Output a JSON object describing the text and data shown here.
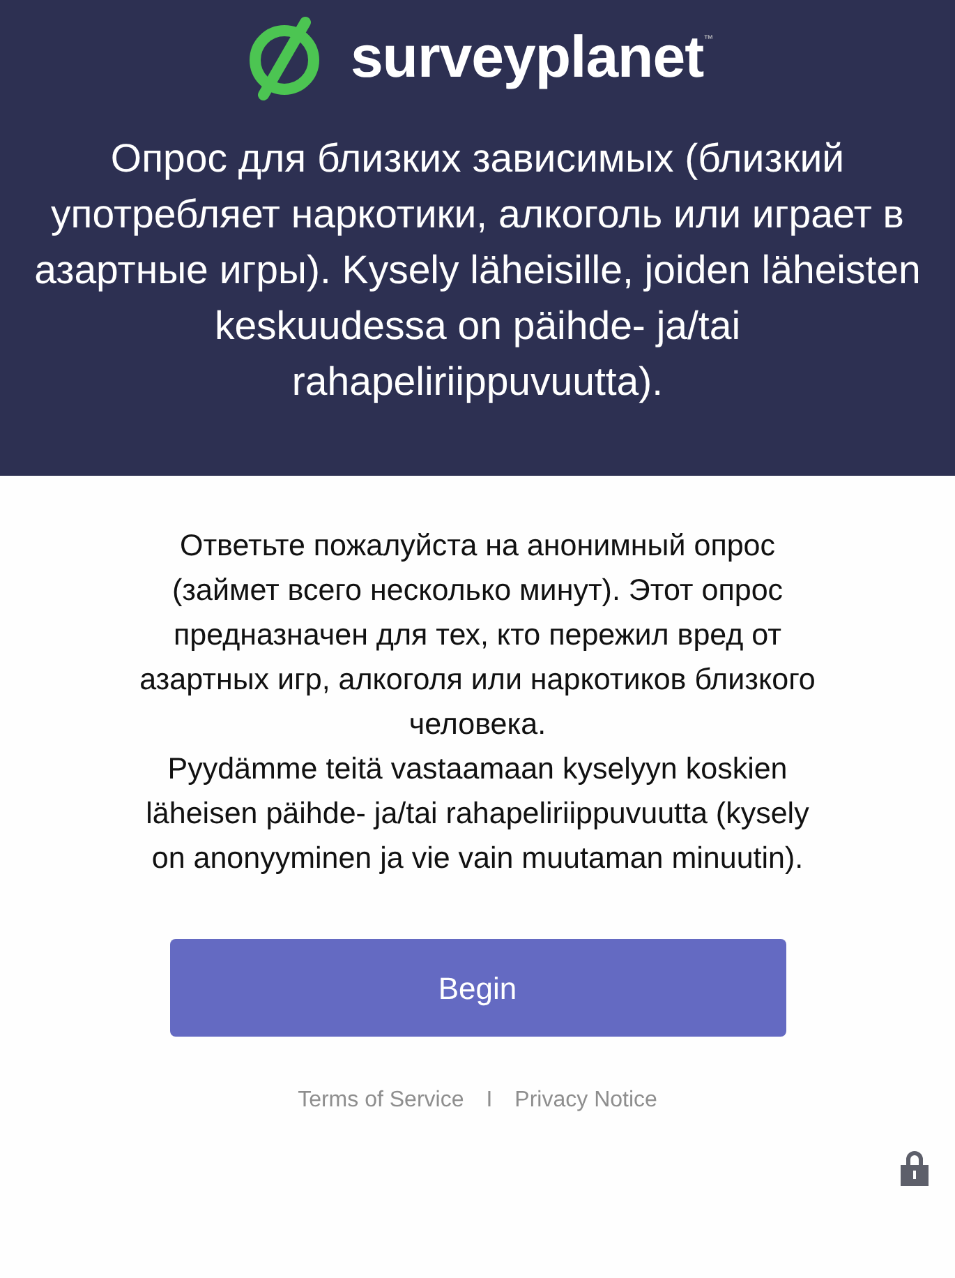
{
  "header": {
    "logo": {
      "name": "surveyplanet",
      "trademark": "™"
    },
    "title": "Опрос для близких зависимых (близкий употребляет наркотики, алкоголь или играет в азартные игры). Kysely läheisille, joiden läheisten keskuudessa on päihde- ja/tai rahapeliriippuvuutta)."
  },
  "intro": [
    "Ответьте пожалуйста на анонимный опрос (займет всего несколько минут). Этот опрос предназначен для тех, кто пережил вред от азартных игр, алкоголя или наркотиков близкого человека.",
    "Pyydämme teitä vastaamaan kyselyyn koskien läheisen päihde- ja/tai rahapeliriippuvuutta (kysely on anonyyminen ja vie vain muutaman minuutin)."
  ],
  "begin_button": "Begin",
  "footer": {
    "links": [
      "Terms of Service",
      "Privacy Notice"
    ],
    "separator": "I"
  }
}
